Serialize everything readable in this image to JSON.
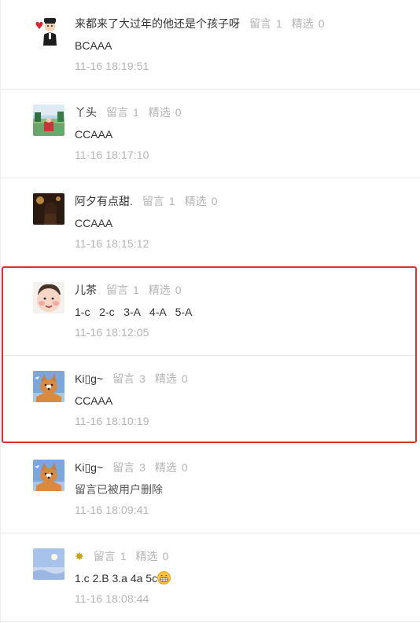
{
  "comments": [
    {
      "nickname": "来都来了大过年的他还是个孩子呀",
      "reply_label": "留言",
      "reply_count": "1",
      "featured_label": "精选",
      "featured_count": "0",
      "content": "BCAAA",
      "timestamp": "11-16 18:19:51",
      "avatar": "cartoon-boy-heart-avatar"
    },
    {
      "nickname": "丫头",
      "reply_label": "留言",
      "reply_count": "1",
      "featured_label": "精选",
      "featured_count": "0",
      "content": "CCAAA",
      "timestamp": "11-16 18:17:10",
      "avatar": "landscape-photo-avatar"
    },
    {
      "nickname": "阿夕有点甜.",
      "reply_label": "留言",
      "reply_count": "1",
      "featured_label": "精选",
      "featured_count": "0",
      "content": "CCAAA",
      "timestamp": "11-16 18:15:12",
      "avatar": "dark-portrait-avatar"
    },
    {
      "nickname": "儿茶",
      "reply_label": "留言",
      "reply_count": "1",
      "featured_label": "精选",
      "featured_count": "0",
      "content": "1-c   2-c   3-A   4-A   5-A",
      "timestamp": "11-16 18:12:05",
      "avatar": "baby-face-avatar"
    },
    {
      "nickname": "K⁠i⁠▯⁠g⁠~",
      "reply_label": "留言",
      "reply_count": "3",
      "featured_label": "精选",
      "featured_count": "0",
      "content": "CCAAA",
      "timestamp": "11-16 18:10:19",
      "avatar": "corgi-dog-avatar"
    },
    {
      "nickname": "K⁠i⁠▯⁠g⁠~",
      "reply_label": "留言",
      "reply_count": "3",
      "featured_label": "精选",
      "featured_count": "0",
      "content": "留言已被用户删除",
      "timestamp": "11-16 18:09:41",
      "avatar": "corgi-dog-avatar"
    },
    {
      "nickname": "✸",
      "reply_label": "留言",
      "reply_count": "1",
      "featured_label": "精选",
      "featured_count": "0",
      "content": "1.c 2.B 3.a 4a 5c",
      "timestamp": "11-16 18:08:44",
      "avatar": "sky-moon-avatar",
      "emoji": "grinning-face-icon"
    }
  ],
  "colors": {
    "highlight_border": "#d9322b",
    "muted_text": "#b4b4b4",
    "body_text": "#333333",
    "divider": "#e8e8e8"
  }
}
